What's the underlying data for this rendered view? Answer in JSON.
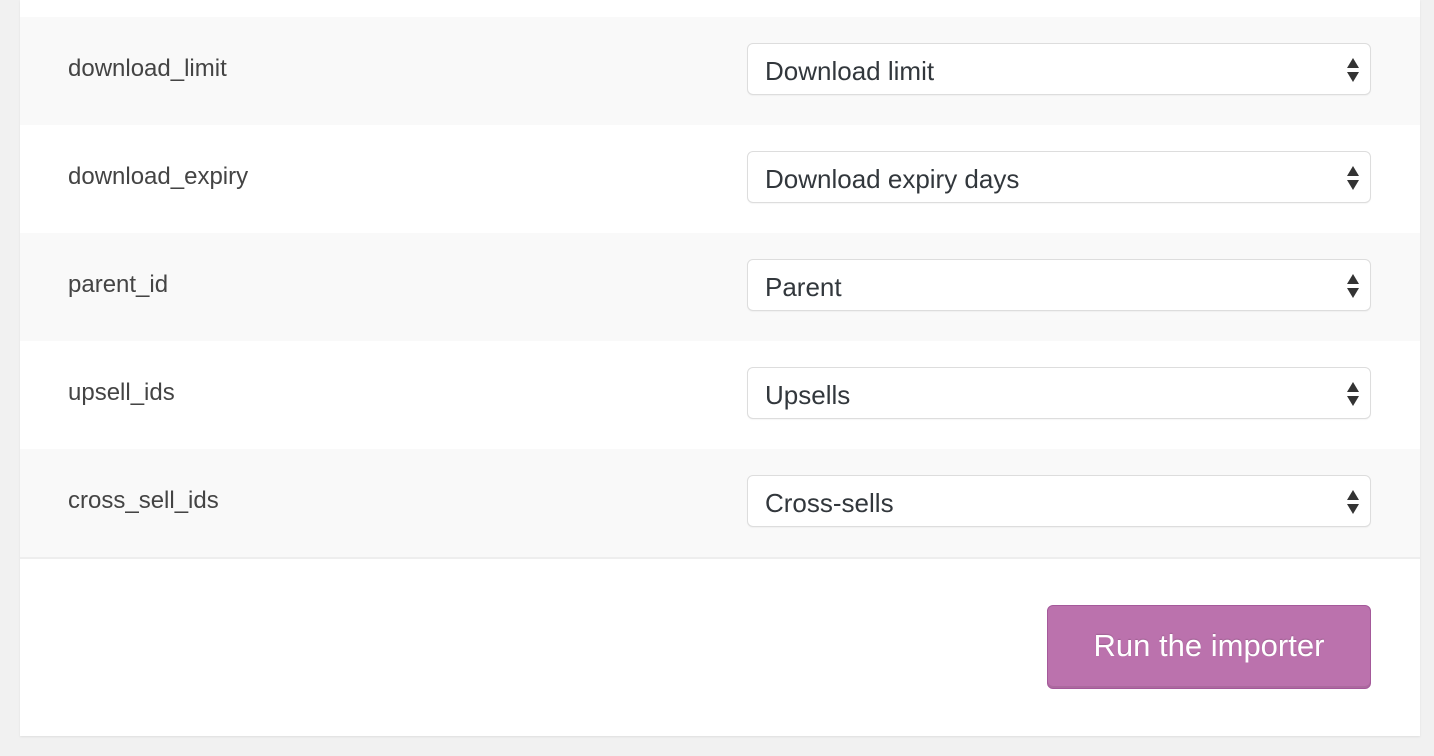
{
  "mapping_rows": [
    {
      "column": "download_limit",
      "field": "Download limit"
    },
    {
      "column": "download_expiry",
      "field": "Download expiry days"
    },
    {
      "column": "parent_id",
      "field": "Parent"
    },
    {
      "column": "upsell_ids",
      "field": "Upsells"
    },
    {
      "column": "cross_sell_ids",
      "field": "Cross-sells"
    }
  ],
  "icons": {
    "select_arrow": "updown-arrows-icon"
  },
  "actions": {
    "run_label": "Run the importer"
  },
  "colors": {
    "accent": "#bb72ad",
    "page_bg": "#f1f1f1"
  }
}
